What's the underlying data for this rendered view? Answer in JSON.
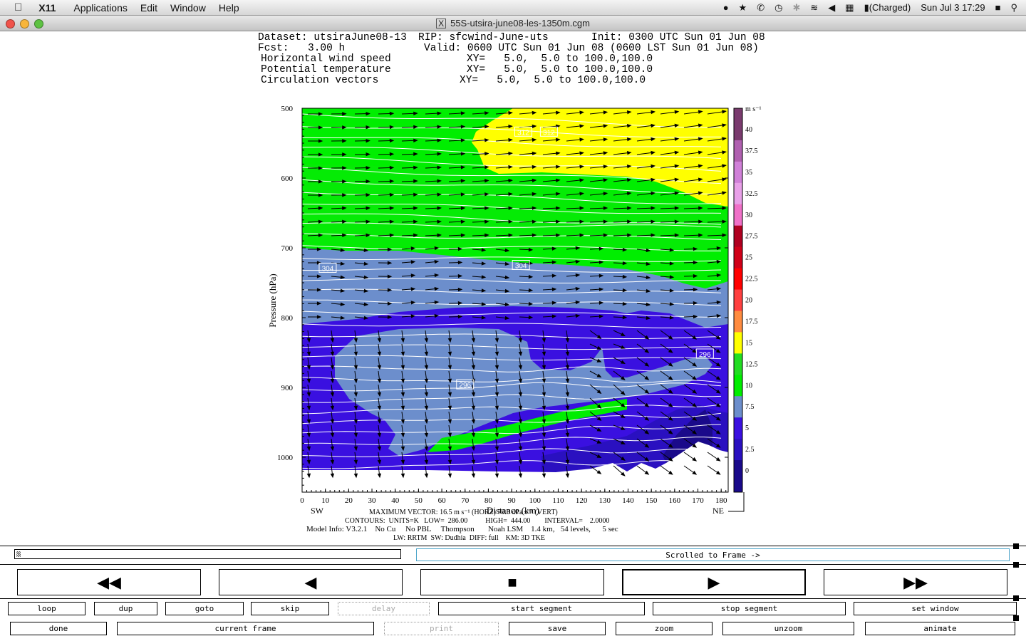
{
  "menubar": {
    "apple": "",
    "app": "X11",
    "items": [
      "Applications",
      "Edit",
      "Window",
      "Help"
    ],
    "battery": "(Charged)",
    "clock": "Sun Jul 3  17:29"
  },
  "window": {
    "title": "55S-utsira-june08-les-1350m.cgm"
  },
  "header": {
    "dataset": "Dataset: utsiraJune08-13",
    "rip": "RIP: sfcwind-June-uts",
    "init": "Init: 0300 UTC Sun 01 Jun 08",
    "fcst_label": "Fcst:",
    "fcst_value": "3.00 h",
    "valid": "Valid: 0600 UTC Sun 01 Jun 08 (0600 LST Sun 01 Jun 08)",
    "fields": [
      {
        "name": "Horizontal wind speed",
        "xy": "XY=   5.0,  5.0 to 100.0,100.0"
      },
      {
        "name": "Potential temperature",
        "xy": "XY=   5.0,  5.0 to 100.0,100.0"
      },
      {
        "name": "Circulation vectors",
        "xy": "XY=   5.0,  5.0 to 100.0,100.0"
      }
    ]
  },
  "chart_data": {
    "type": "heatmap",
    "title": "",
    "xlabel": "Distance (km)",
    "ylabel": "Pressure (hPa)",
    "x_ticks": [
      0,
      10,
      20,
      30,
      40,
      50,
      60,
      70,
      80,
      90,
      100,
      110,
      120,
      130,
      140,
      150,
      160,
      170,
      180
    ],
    "y_ticks": [
      500,
      600,
      700,
      800,
      900,
      1000
    ],
    "xlim": [
      0,
      183
    ],
    "ylim": [
      1050,
      500
    ],
    "x_end_labels": {
      "left": "SW",
      "right": "NE"
    },
    "colorbar": {
      "units": "m s⁻¹",
      "levels": [
        "40",
        "37.5",
        "35",
        "32.5",
        "30",
        "27.5",
        "25",
        "22.5",
        "20",
        "17.5",
        "15",
        "12.5",
        "10",
        "7.5",
        "5",
        "2.5",
        "0"
      ],
      "colors": [
        "#7a3b6e",
        "#b060b0",
        "#d080d8",
        "#e8a0e8",
        "#f070c8",
        "#b00020",
        "#d00018",
        "#ff0000",
        "#ff4040",
        "#ff8c40",
        "#ffff00",
        "#22dd22",
        "#00ee00",
        "#6c8ecc",
        "#3a10e0",
        "#2a10c0",
        "#1a0a8a"
      ]
    },
    "contour_labels": [
      {
        "value": "312",
        "x": 95,
        "p": 534
      },
      {
        "value": "312",
        "x": 106,
        "p": 534
      },
      {
        "value": "304",
        "x": 11,
        "p": 729
      },
      {
        "value": "304",
        "x": 94,
        "p": 725
      },
      {
        "value": "296",
        "x": 70,
        "p": 896
      },
      {
        "value": "296",
        "x": 173,
        "p": 852
      }
    ],
    "regions": {
      "wind_speed_bands": [
        "0-2.5",
        "2.5-5",
        "5-7.5",
        "7.5-10",
        "10-12.5",
        "12.5-15",
        "15-17.5"
      ]
    }
  },
  "footer": {
    "max_vector": "MAXIMUM VECTOR:  16.5 m s⁻¹ (HORZ)    70.3 dPa s⁻¹ (VERT)",
    "contours": "CONTOURS:  UNITS=K   LOW=  286.00          HIGH=  444.00        INTERVAL=    2.0000",
    "model_info": "Model Info: V3.2.1    No Cu     No PBL     Thompson       Noah LSM    1.4 km,   54 levels,      5 sec",
    "model_info2": "LW: RRTM  SW: Dudhia  DIFF: full    KM: 3D TKE"
  },
  "controls": {
    "status": "Scrolled to Frame ->",
    "big": [
      {
        "name": "rewind-button",
        "label": "◀◀"
      },
      {
        "name": "step-back-button",
        "label": "◀"
      },
      {
        "name": "stop-button",
        "label": "■"
      },
      {
        "name": "play-button",
        "label": "▶"
      },
      {
        "name": "fast-forward-button",
        "label": "▶▶"
      }
    ],
    "row1": [
      "loop",
      "dup",
      "goto",
      "skip",
      "delay",
      "start segment",
      "stop segment",
      "set window"
    ],
    "row2": [
      "done",
      "current frame",
      "print",
      "save",
      "zoom",
      "unzoom",
      "animate"
    ]
  }
}
